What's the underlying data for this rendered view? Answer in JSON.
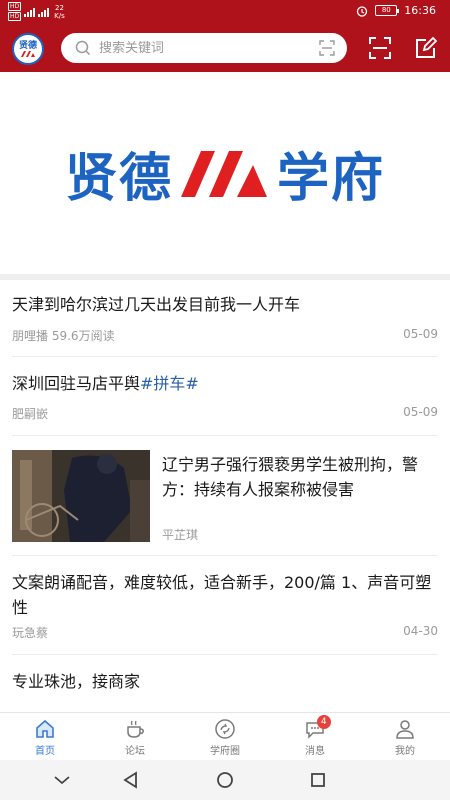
{
  "status_bar": {
    "sim1": "HD",
    "sim2": "HD",
    "net_speed_value": "22",
    "net_speed_unit": "K/s",
    "battery": "80",
    "time": "16:36"
  },
  "header": {
    "logo_text": "贤德",
    "search_placeholder": "搜索关键词",
    "brand_color": "#b0121c"
  },
  "banner": {
    "left_text": "贤德",
    "right_text": "学府"
  },
  "feed": [
    {
      "title": "天津到哈尔滨过几天出发目前我一人开车",
      "tag": "",
      "author": "朋哩播",
      "reads": "59.6万阅读",
      "date": "05-09",
      "has_image": false
    },
    {
      "title": "深圳回驻马店平舆",
      "tag": "#拼车#",
      "author": "肥嗣嵌",
      "reads": "",
      "date": "05-09",
      "has_image": false
    },
    {
      "title": "辽宁男子强行猥亵男学生被刑拘，警方：持续有人报案称被侵害",
      "tag": "",
      "author": "平芷琪",
      "reads": "",
      "date": "",
      "has_image": true
    },
    {
      "title": "文案朗诵配音，难度较低，适合新手，200/篇 1、声音可塑性",
      "tag": "",
      "author": "玩急蔡",
      "reads": "",
      "date": "04-30",
      "has_image": false
    },
    {
      "title": "专业珠池，接商家",
      "tag": "",
      "author": "",
      "reads": "",
      "date": "",
      "has_image": false
    }
  ],
  "tabs": [
    {
      "label": "首页",
      "icon": "home-icon",
      "active": true
    },
    {
      "label": "论坛",
      "icon": "coffee-cup-icon",
      "active": false
    },
    {
      "label": "学府圈",
      "icon": "refresh-circle-icon",
      "active": false
    },
    {
      "label": "消息",
      "icon": "chat-bubble-icon",
      "active": false,
      "badge": "4"
    },
    {
      "label": "我的",
      "icon": "user-icon",
      "active": false
    }
  ],
  "colors": {
    "accent_blue": "#3a7bd5",
    "tag_blue": "#2b5fa8",
    "badge_red": "#e8413c"
  }
}
